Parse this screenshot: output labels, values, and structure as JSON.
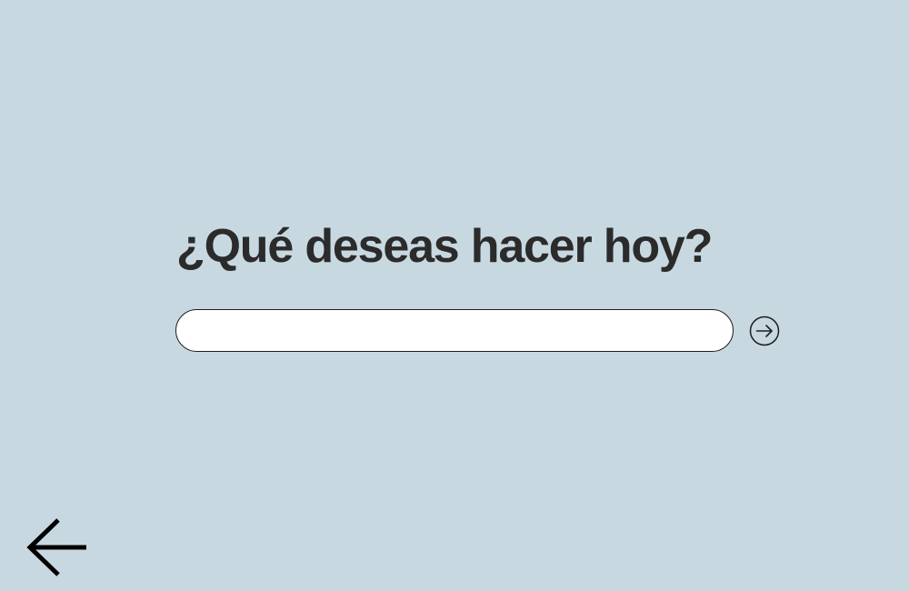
{
  "prompt": {
    "title": "¿Qué deseas hacer hoy?"
  },
  "search": {
    "value": "",
    "placeholder": ""
  },
  "icons": {
    "submit": "arrow-right-circle-icon",
    "back": "arrow-left-icon"
  },
  "colors": {
    "background": "#c8d8e0",
    "text": "#2b2b2b",
    "input_background": "#ffffff",
    "stroke": "#1e1e1e"
  }
}
